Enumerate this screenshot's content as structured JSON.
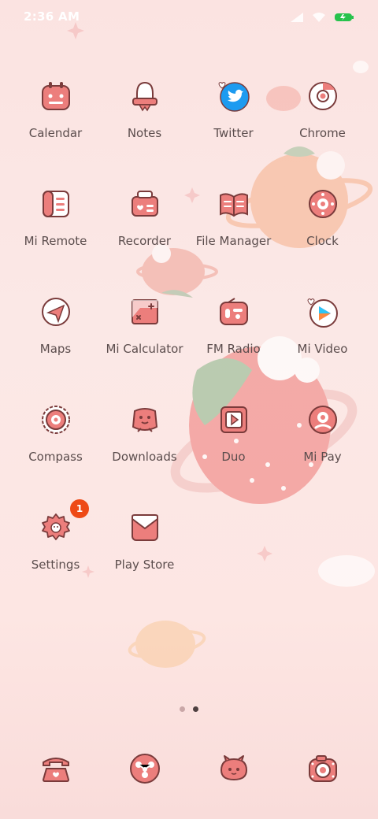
{
  "status_bar": {
    "time": "2:36 AM",
    "signal_icon": "signal-icon",
    "wifi_icon": "wifi-icon",
    "battery_icon": "battery-icon"
  },
  "colors": {
    "icon_pink": "#ec7e7c",
    "icon_line": "#7a3b3b",
    "badge": "#ee4a16",
    "label": "#5b4d4d"
  },
  "apps": [
    [
      {
        "label": "Calendar",
        "icon": "calendar-icon"
      },
      {
        "label": "Notes",
        "icon": "notes-icon"
      },
      {
        "label": "Twitter",
        "icon": "twitter-icon"
      },
      {
        "label": "Chrome",
        "icon": "chrome-icon"
      }
    ],
    [
      {
        "label": "Mi Remote",
        "icon": "remote-icon"
      },
      {
        "label": "Recorder",
        "icon": "recorder-icon"
      },
      {
        "label": "File Manager",
        "icon": "folder-icon"
      },
      {
        "label": "Clock",
        "icon": "clock-icon"
      }
    ],
    [
      {
        "label": "Maps",
        "icon": "maps-icon"
      },
      {
        "label": "Mi Calculator",
        "icon": "calculator-icon"
      },
      {
        "label": "FM Radio",
        "icon": "radio-icon"
      },
      {
        "label": "Mi Video",
        "icon": "video-icon"
      }
    ],
    [
      {
        "label": "Compass",
        "icon": "compass-icon"
      },
      {
        "label": "Downloads",
        "icon": "downloads-icon"
      },
      {
        "label": "Duo",
        "icon": "duo-icon"
      },
      {
        "label": "Mi Pay",
        "icon": "pay-icon"
      }
    ],
    [
      {
        "label": "Settings",
        "icon": "settings-icon",
        "badge": "1"
      },
      {
        "label": "Play Store",
        "icon": "playstore-icon"
      }
    ]
  ],
  "page_indicator": {
    "pages": 2,
    "current": 2
  },
  "dock": [
    {
      "icon": "phone-icon"
    },
    {
      "icon": "share-icon"
    },
    {
      "icon": "messaging-icon"
    },
    {
      "icon": "camera-icon"
    }
  ]
}
